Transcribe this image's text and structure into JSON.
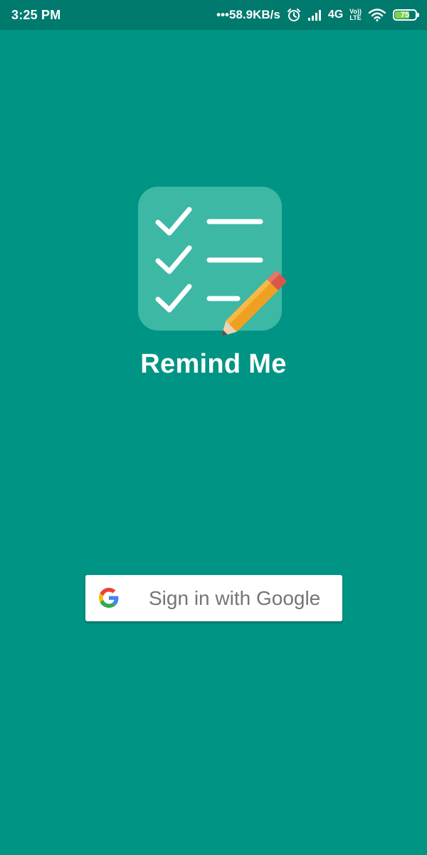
{
  "status_bar": {
    "time": "3:25 PM",
    "net_speed": "•••58.9KB/s",
    "network_type": "4G",
    "volte_top": "Vo))",
    "volte_bottom": "LTE",
    "battery_level": "75",
    "battery_fraction": 0.75,
    "icons": [
      "alarm-icon",
      "signal-icon",
      "volte-icon",
      "wifi-icon",
      "battery-icon"
    ]
  },
  "app": {
    "title": "Remind Me",
    "logo_icon": "checklist-pencil-icon"
  },
  "sign_in": {
    "label": "Sign in with Google",
    "icon": "google-g-icon"
  },
  "colors": {
    "background": "#009485",
    "status_bar": "#007a6d",
    "logo_tile": "#3db8a5",
    "button_text": "#757575",
    "pencil_body": "#f0a020",
    "pencil_eraser": "#d9574a"
  }
}
